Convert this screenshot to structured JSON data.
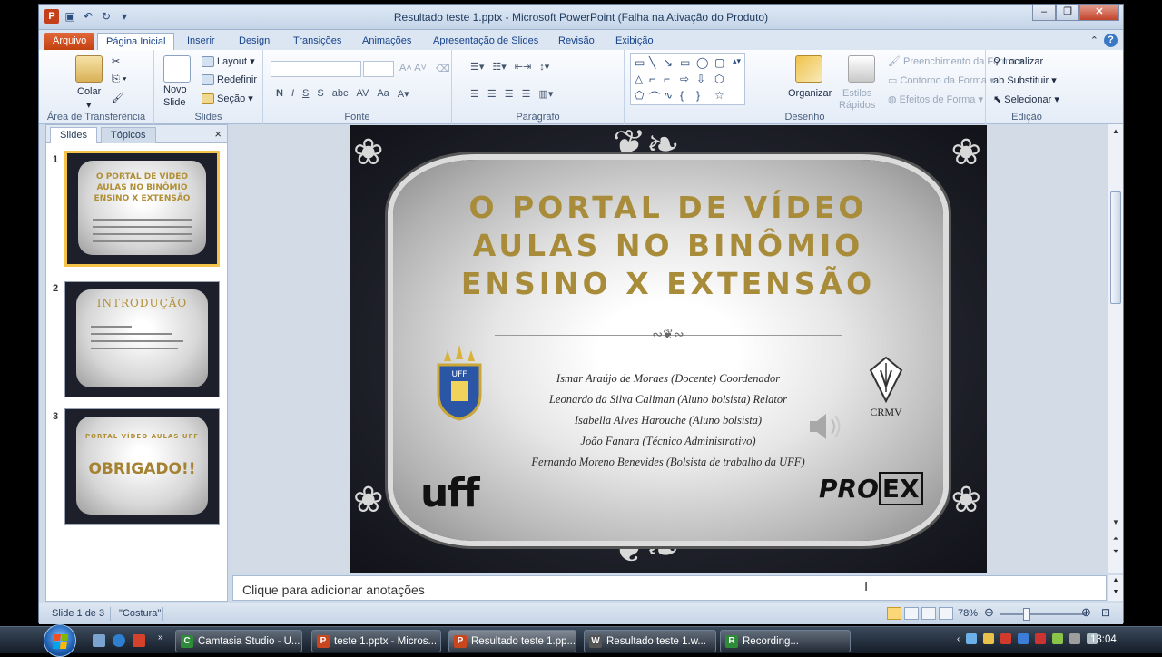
{
  "window": {
    "title": "Resultado teste 1.pptx  -  Microsoft PowerPoint (Falha na Ativação do Produto)",
    "app_icon": "P"
  },
  "tabs": [
    {
      "label": "Arquivo"
    },
    {
      "label": "Página Inicial"
    },
    {
      "label": "Inserir"
    },
    {
      "label": "Design"
    },
    {
      "label": "Transições"
    },
    {
      "label": "Animações"
    },
    {
      "label": "Apresentação de Slides"
    },
    {
      "label": "Revisão"
    },
    {
      "label": "Exibição"
    }
  ],
  "ribbon": {
    "clipboard": {
      "label": "Área de Transferência",
      "paste": "Colar"
    },
    "slides": {
      "label": "Slides",
      "new_slide_1": "Novo",
      "new_slide_2": "Slide",
      "layout": "Layout",
      "reset": "Redefinir",
      "section": "Seção"
    },
    "font": {
      "label": "Fonte",
      "bold": "N",
      "italic": "I",
      "underline": "S",
      "shadow": "S",
      "strike": "abc",
      "spacing": "AV",
      "case": "Aa"
    },
    "paragraph": {
      "label": "Parágrafo"
    },
    "drawing": {
      "label": "Desenho",
      "arrange": "Organizar",
      "quick_styles_1": "Estilos",
      "quick_styles_2": "Rápidos",
      "fill": "Preenchimento da Forma",
      "outline": "Contorno da Forma",
      "effects": "Efeitos de Forma"
    },
    "editing": {
      "label": "Edição",
      "find": "Localizar",
      "replace": "Substituir",
      "select": "Selecionar"
    }
  },
  "panel": {
    "tab_slides": "Slides",
    "tab_outline": "Tópicos",
    "close": "×",
    "thumbs": [
      {
        "num": "1",
        "title": "O PORTAL DE VÍDEO AULAS NO BINÔMIO ENSINO X EXTENSÃO"
      },
      {
        "num": "2",
        "title": "INTRODUÇÃO"
      },
      {
        "num": "3",
        "title": "PORTAL VÍDEO AULAS UFF",
        "big": "OBRIGADO!!"
      }
    ]
  },
  "slide": {
    "title_lines": [
      "O PORTAL DE VÍDEO",
      "AULAS NO BINÔMIO",
      "ENSINO X EXTENSÃO"
    ],
    "names": [
      "Ismar Araújo de Moraes (Docente) Coordenador",
      "Leonardo da Silva Caliman (Aluno bolsista) Relator",
      "Isabella Alves Harouche (Aluno bolsista)",
      "João Fanara (Técnico Administrativo)",
      "Fernando Moreno Benevides (Bolsista de trabalho da UFF)"
    ],
    "crmv": "CRMV",
    "uff": "uff",
    "proex_a": "PRO",
    "proex_b": "EX"
  },
  "notes": {
    "placeholder": "Clique para adicionar anotações"
  },
  "status": {
    "slide_info": "Slide 1 de 3",
    "theme": "\"Costura\"",
    "zoom": "78%"
  },
  "taskbar": {
    "items": [
      {
        "label": "Camtasia Studio - U...",
        "color": "#2e8b3a",
        "icon": "C"
      },
      {
        "label": "teste 1.pptx - Micros...",
        "color": "#c9461e",
        "icon": "P"
      },
      {
        "label": "Resultado teste 1.pp...",
        "color": "#c9461e",
        "icon": "P"
      },
      {
        "label": "Resultado teste 1.w...",
        "color": "#555",
        "icon": "W"
      },
      {
        "label": "Recording...",
        "color": "#2e8b3a",
        "icon": "R"
      }
    ],
    "clock": "13:04"
  }
}
